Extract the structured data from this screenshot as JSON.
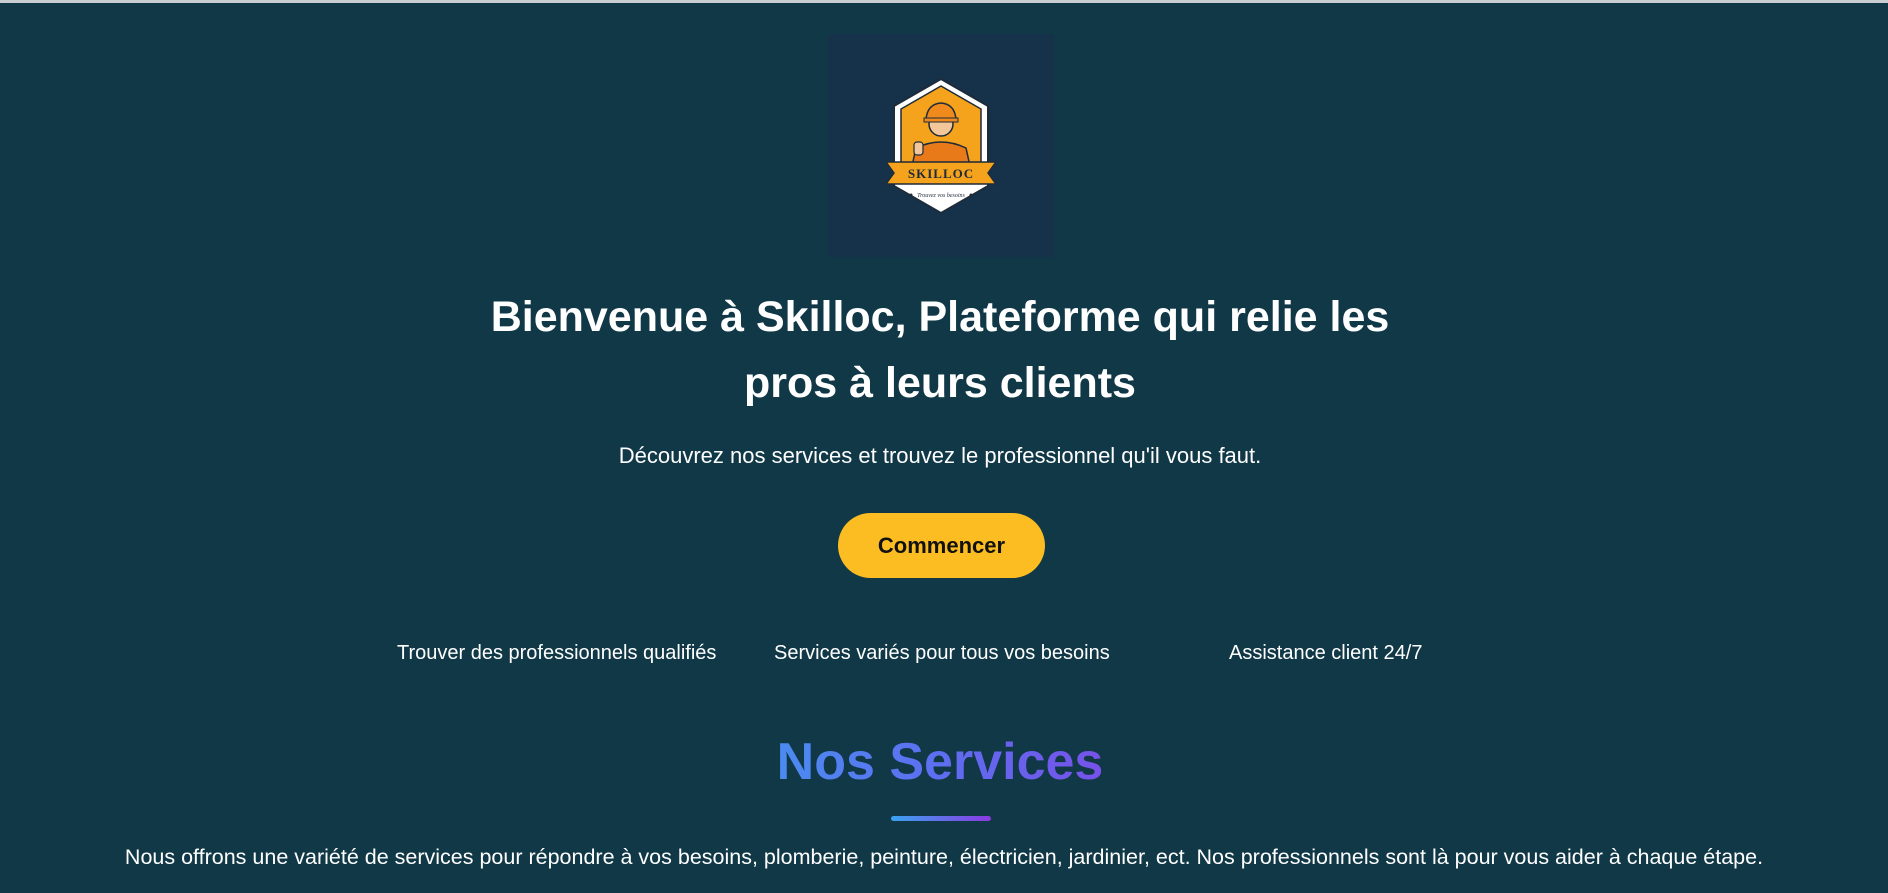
{
  "logo": {
    "name": "SKILLOC",
    "tagline": "Trouvez vos besoins",
    "icon": "worker-thumbs-up-badge"
  },
  "hero": {
    "title": "Bienvenue à Skilloc, Plateforme qui relie les pros à leurs clients",
    "subtitle": "Découvrez nos services et trouvez le professionnel qu'il vous faut.",
    "cta_label": "Commencer"
  },
  "features": [
    {
      "label": "Trouver des professionnels qualifiés"
    },
    {
      "label": "Services variés pour tous vos besoins"
    },
    {
      "label": "Assistance client 24/7"
    }
  ],
  "services": {
    "title": "Nos Services",
    "description": "Nous offrons une variété de services pour répondre à vos besoins, plomberie, peinture, électricien, jardinier, ect. Nos professionnels sont là pour vous aider à chaque étape."
  },
  "colors": {
    "background": "#103847",
    "logo_panel": "#15324a",
    "accent": "#fbbd22",
    "gradient_start": "#3aa3f0",
    "gradient_end": "#8b3ae2"
  }
}
